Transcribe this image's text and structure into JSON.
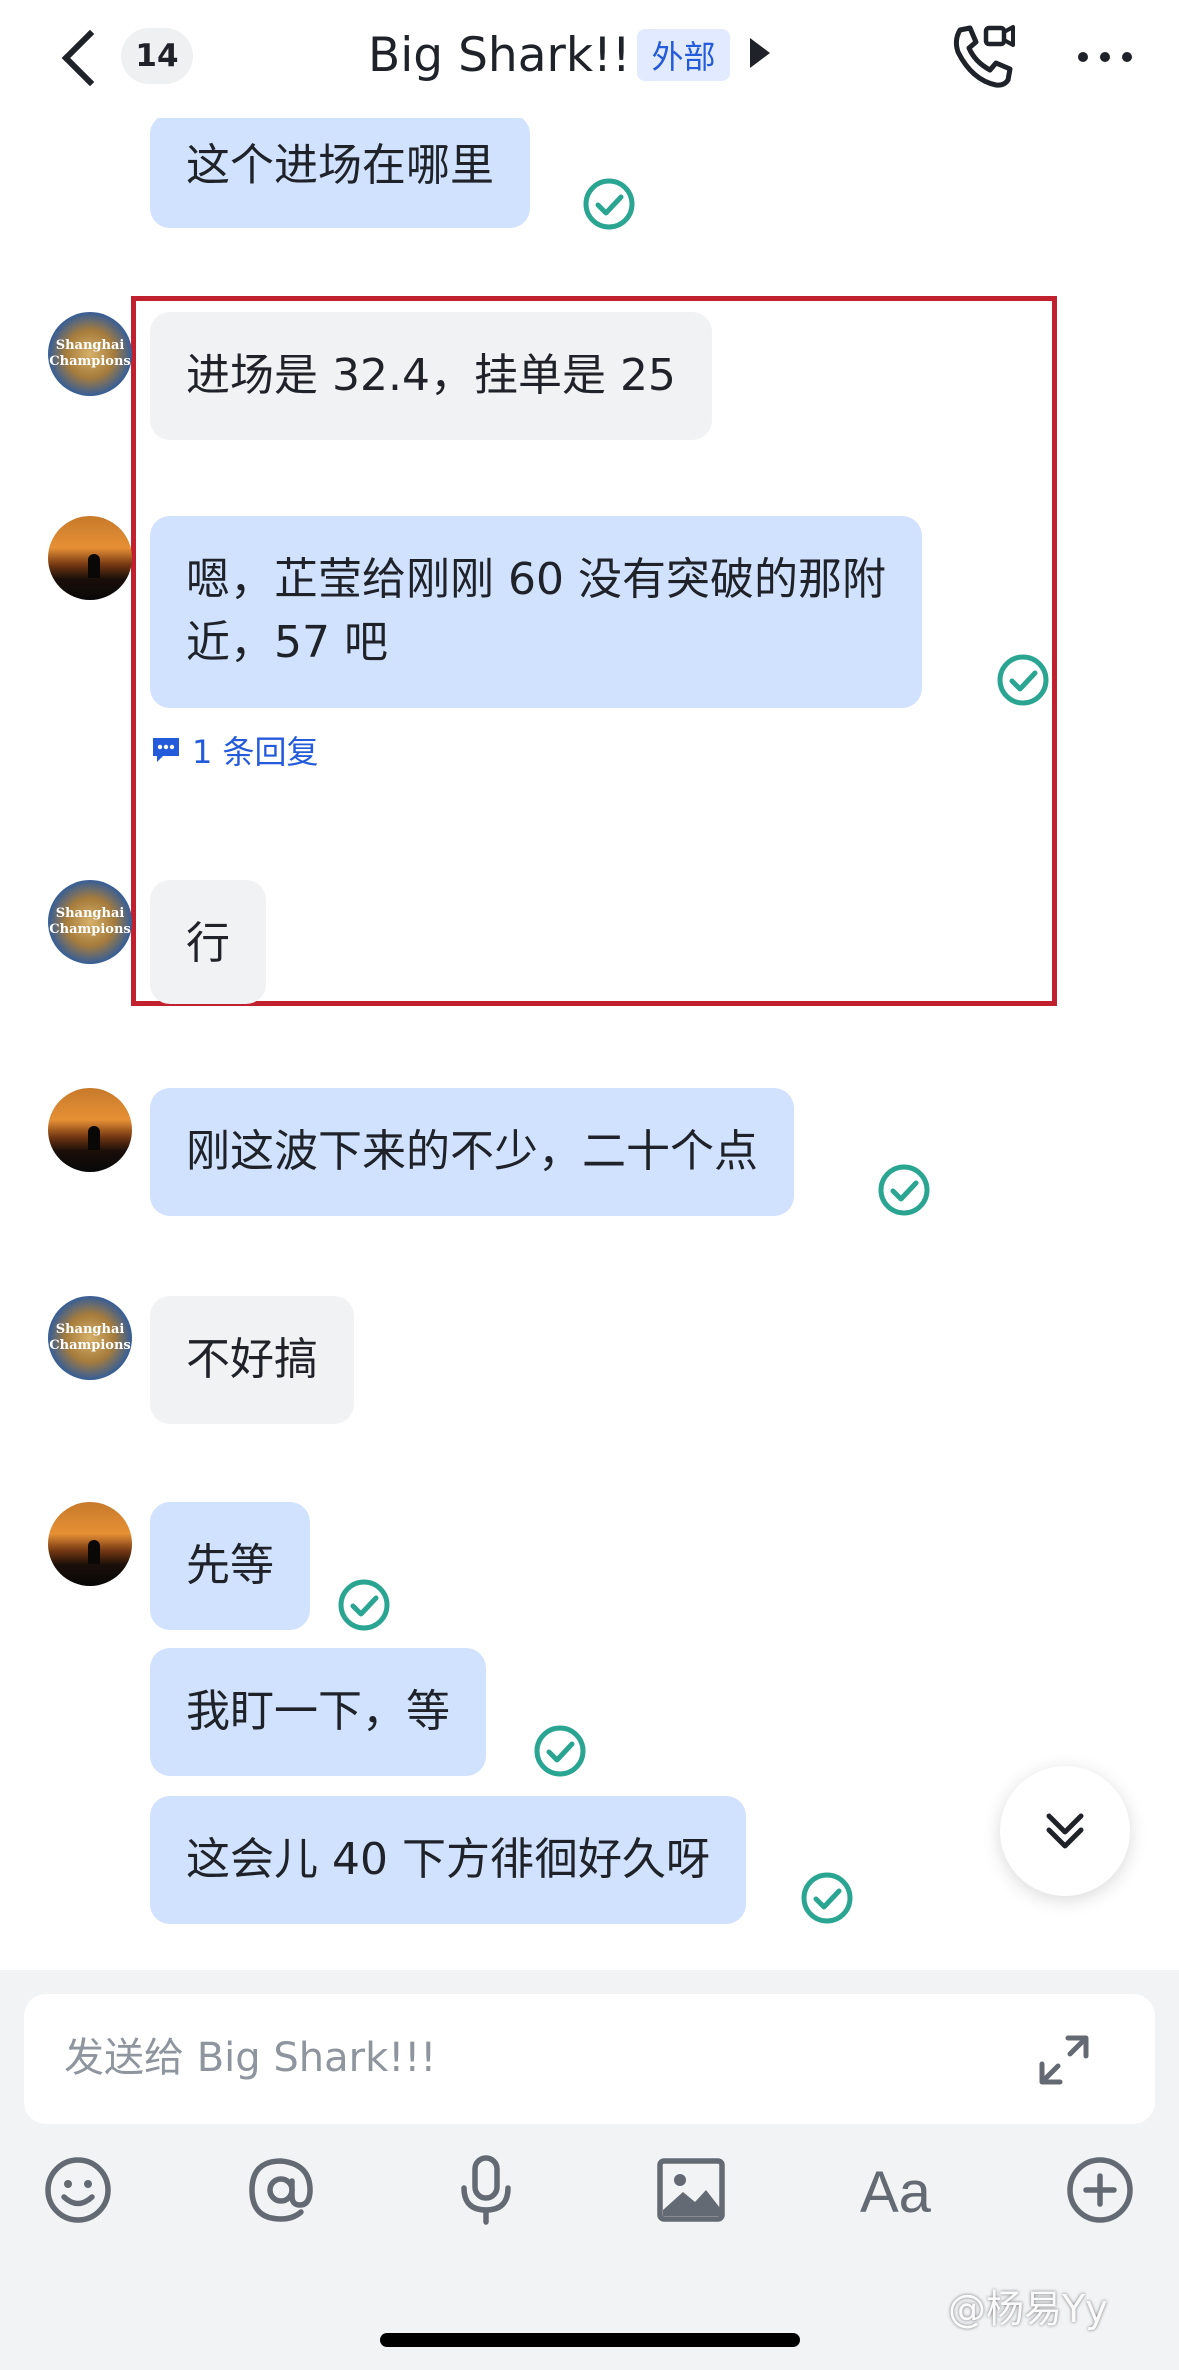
{
  "header": {
    "unread_count": "14",
    "title": "Big Shark!!!",
    "external_tag": "外部"
  },
  "messages": [
    {
      "sender": "me",
      "text": "这个进场在哪里",
      "read": true
    },
    {
      "sender": "shanghai-champions",
      "text": "进场是 32.4，挂单是 25"
    },
    {
      "sender": "me",
      "lines": [
        "嗯，芷莹给刚刚 60 没有突破的那附",
        "近，57 吧"
      ],
      "read": true,
      "reply_count_text": "1 条回复"
    },
    {
      "sender": "shanghai-champions",
      "text": "行"
    },
    {
      "sender": "me",
      "text": "刚这波下来的不少，二十个点",
      "read": true
    },
    {
      "sender": "shanghai-champions",
      "text": "不好搞"
    },
    {
      "sender": "me",
      "text": "先等",
      "read": true
    },
    {
      "sender": "me",
      "text": "我盯一下，等",
      "read": true
    },
    {
      "sender": "me",
      "text": "这会儿 40 下方徘徊好久呀",
      "read": true
    }
  ],
  "avatar_badge_text": [
    "Shanghai",
    "Champions"
  ],
  "composer": {
    "placeholder": "发送给 Big Shark!!!",
    "font_button_label": "Aa"
  },
  "toolbar_icons": [
    "emoji-icon",
    "mention-icon",
    "microphone-icon",
    "image-icon",
    "font-style-icon",
    "plus-icon"
  ],
  "watermark": "@杨易Yy",
  "colors": {
    "my_bubble": "#d1e2ff",
    "their_bubble": "#f1f2f3",
    "read_check": "#2aa591",
    "highlight_border": "#c1202e",
    "link": "#245bdb"
  }
}
